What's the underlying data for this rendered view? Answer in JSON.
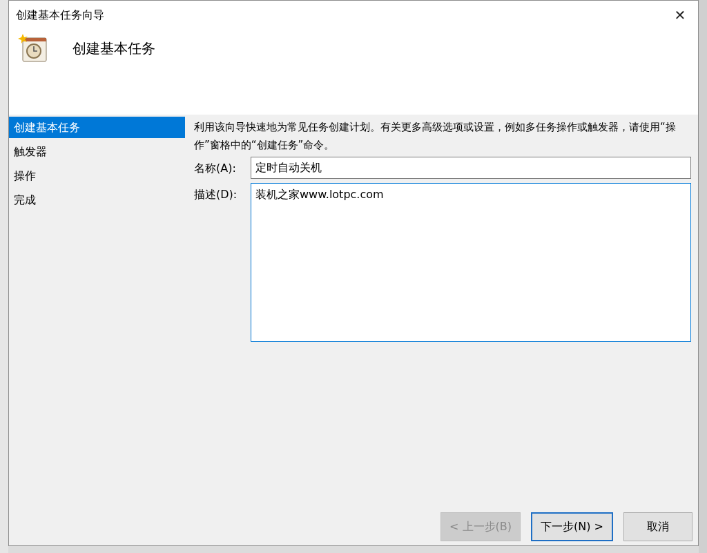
{
  "window": {
    "title": "创建基本任务向导",
    "close": "✕"
  },
  "header": {
    "title": "创建基本任务"
  },
  "nav": {
    "items": [
      {
        "label": "创建基本任务",
        "selected": true
      },
      {
        "label": "触发器",
        "selected": false
      },
      {
        "label": "操作",
        "selected": false
      },
      {
        "label": "完成",
        "selected": false
      }
    ]
  },
  "intro": "利用该向导快速地为常见任务创建计划。有关更多高级选项或设置，例如多任务操作或触发器，请使用“操作”窗格中的“创建任务”命令。",
  "fields": [
    {
      "kind": "line",
      "label": "名称(A):",
      "value": "定时自动关机"
    },
    {
      "kind": "multiline",
      "label": "描述(D):",
      "value": "装机之家www.lotpc.com"
    }
  ],
  "buttons": [
    {
      "label": "< 上一步(B)",
      "disabled": true,
      "default": false
    },
    {
      "label": "下一步(N) >",
      "disabled": false,
      "default": true
    },
    {
      "label": "取消",
      "disabled": false,
      "default": false
    }
  ]
}
